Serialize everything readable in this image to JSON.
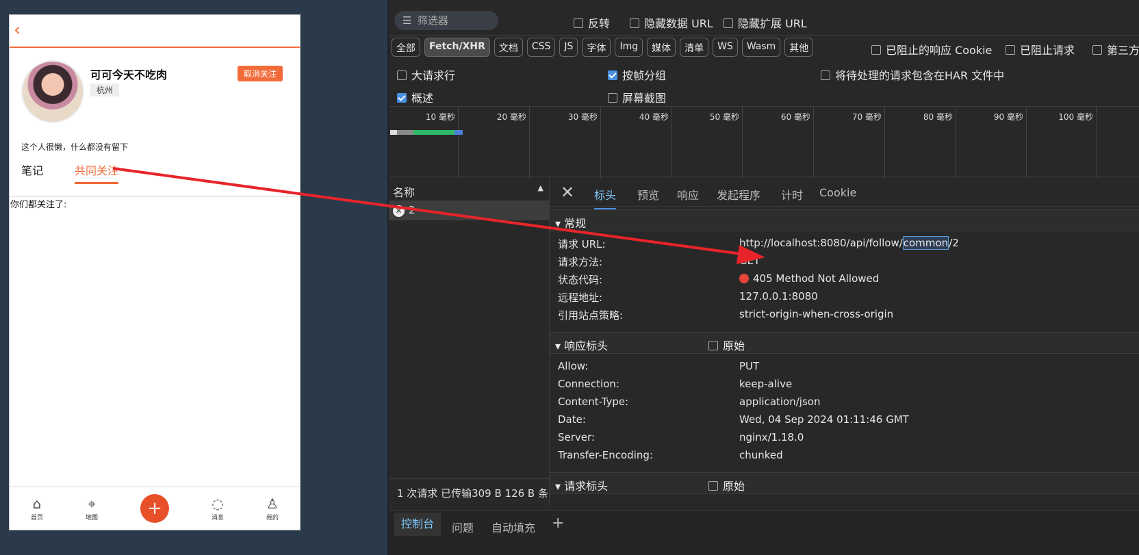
{
  "phone": {
    "back_glyph": "‹",
    "username": "可可今天不吃肉",
    "city": "杭州",
    "unfollow": "取消关注",
    "bio": "这个人很懒，什么都没有留下",
    "tab_notes": "笔记",
    "tab_common": "共同关注",
    "common_label": "你们都关注了:",
    "nav": [
      {
        "label": "首页",
        "icon": "home-icon"
      },
      {
        "label": "地图",
        "icon": "map-pin-icon"
      },
      {
        "label": "+",
        "icon": "plus-icon"
      },
      {
        "label": "消息",
        "icon": "message-icon"
      },
      {
        "label": "我的",
        "icon": "user-icon"
      }
    ]
  },
  "devtools": {
    "filter_placeholder": "筛选器",
    "invert": "反转",
    "hide_data_url": "隐藏数据 URL",
    "hide_ext_url": "隐藏扩展 URL",
    "chips": [
      "全部",
      "Fetch/XHR",
      "文档",
      "CSS",
      "JS",
      "字体",
      "Img",
      "媒体",
      "清单",
      "WS",
      "Wasm",
      "其他"
    ],
    "active_chip": "Fetch/XHR",
    "blocked_cookie": "已阻止的响应 Cookie",
    "blocked_req": "已阻止请求",
    "third_party": "第三方",
    "big_rows": "大请求行",
    "group_by_frame": "按帧分组",
    "har_pending": "将待处理的请求包含在HAR 文件中",
    "overview": "概述",
    "screenshot": "屏幕截图",
    "ticks": [
      "10 毫秒",
      "20 毫秒",
      "30 毫秒",
      "40 毫秒",
      "50 毫秒",
      "60 毫秒",
      "70 毫秒",
      "80 毫秒",
      "90 毫秒",
      "100 毫秒"
    ],
    "name_header": "名称",
    "request_name": "2",
    "status_text": "1 次请求  已传输309 B  126 B 条",
    "detail_tabs": [
      "标头",
      "预览",
      "响应",
      "发起程序",
      "计时",
      "Cookie"
    ],
    "active_detail_tab": "标头",
    "general_title": "常规",
    "general": [
      {
        "k": "请求 URL:",
        "v": "http://localhost:8080/api/follow/common/2"
      },
      {
        "k": "请求方法:",
        "v": "GET"
      },
      {
        "k": "状态代码:",
        "v": "405 Method Not Allowed"
      },
      {
        "k": "远程地址:",
        "v": "127.0.0.1:8080"
      },
      {
        "k": "引用站点策略:",
        "v": "strict-origin-when-cross-origin"
      }
    ],
    "url_prefix": "http://localhost:8080/api/follow/",
    "url_highlight": "common",
    "url_suffix": "/2",
    "response_headers_title": "响应标头",
    "raw": "原始",
    "response_headers": [
      {
        "k": "Allow:",
        "v": "PUT"
      },
      {
        "k": "Connection:",
        "v": "keep-alive"
      },
      {
        "k": "Content-Type:",
        "v": "application/json"
      },
      {
        "k": "Date:",
        "v": "Wed, 04 Sep 2024 01:11:46 GMT"
      },
      {
        "k": "Server:",
        "v": "nginx/1.18.0"
      },
      {
        "k": "Transfer-Encoding:",
        "v": "chunked"
      }
    ],
    "request_headers_title": "请求标头",
    "console_tabs": [
      "控制台",
      "问题",
      "自动填充"
    ],
    "add_tab": "+"
  },
  "colors": {
    "accent": "#f26b3a",
    "error": "#e8453c",
    "link": "#7cc4f4",
    "arrow": "#e8242a"
  }
}
